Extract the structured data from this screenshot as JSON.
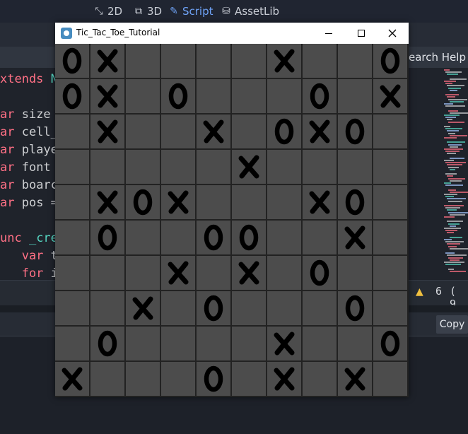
{
  "editor": {
    "modes": [
      {
        "label": "2D",
        "icon": "move-icon"
      },
      {
        "label": "3D",
        "icon": "cube-icon"
      },
      {
        "label": "Script",
        "icon": "script-icon"
      },
      {
        "label": "AssetLib",
        "icon": "assetlib-icon"
      }
    ],
    "search_help": "earch Help",
    "code_lines": [
      {
        "kw": "xtends ",
        "tx": "N"
      },
      {
        "kw": "",
        "tx": ""
      },
      {
        "kw": "ar ",
        "tx": "size"
      },
      {
        "kw": "ar ",
        "tx": "cell_"
      },
      {
        "kw": "ar ",
        "tx": "playe"
      },
      {
        "kw": "ar ",
        "tx": "font"
      },
      {
        "kw": "ar ",
        "tx": "boarc"
      },
      {
        "kw": "ar ",
        "tx": "pos ="
      },
      {
        "kw": "",
        "tx": ""
      },
      {
        "kw": "unc ",
        "tx": "_cre"
      },
      {
        "kw": "   var ",
        "tx": "t"
      },
      {
        "kw": "   for ",
        "tx": "i"
      }
    ],
    "warning_count": "6",
    "warning_paren": "( 9",
    "copy_label": "Copy"
  },
  "window": {
    "title": "Tic_Tac_Toe_Tutorial",
    "board": [
      [
        "O",
        "X",
        "",
        "",
        "",
        "",
        "X",
        "",
        "",
        "O"
      ],
      [
        "O",
        "X",
        "",
        "O",
        "",
        "",
        "",
        "O",
        "",
        "X"
      ],
      [
        "",
        "X",
        "",
        "",
        "X",
        "",
        "O",
        "X",
        "O",
        ""
      ],
      [
        "",
        "",
        "",
        "",
        "",
        "X",
        "",
        "",
        "",
        ""
      ],
      [
        "",
        "X",
        "O",
        "X",
        "",
        "",
        "",
        "X",
        "O",
        ""
      ],
      [
        "",
        "O",
        "",
        "",
        "O",
        "O",
        "",
        "",
        "X",
        ""
      ],
      [
        "",
        "",
        "",
        "X",
        "",
        "X",
        "",
        "O",
        "",
        ""
      ],
      [
        "",
        "",
        "X",
        "",
        "O",
        "",
        "",
        "",
        "O",
        ""
      ],
      [
        "",
        "O",
        "",
        "",
        "",
        "",
        "X",
        "",
        "",
        "O"
      ],
      [
        "X",
        "",
        "",
        "",
        "O",
        "",
        "X",
        "",
        "X",
        ""
      ]
    ]
  }
}
